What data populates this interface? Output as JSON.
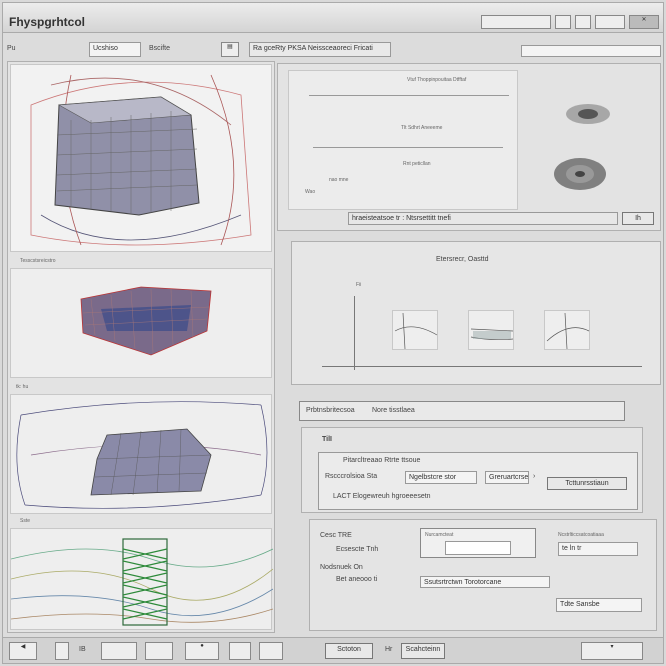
{
  "window": {
    "menu_text": "                         ",
    "title": "Fhyspgrhtcol",
    "title_buttons": [
      "",
      "",
      "",
      "",
      ""
    ]
  },
  "toolbar": {
    "left_label": "Pu",
    "field_a": "Ucshiso",
    "field_b": "Bscifte",
    "path_label": "Ra gceRty PKSA Neissceaoreci Fricati",
    "search_value": ""
  },
  "left_panel": {
    "view2_label": "Tesscstsreicstro",
    "view3_label": "tk: hu",
    "view4_label": "Sste"
  },
  "right_top": {
    "header": "Vtuf Thoppinpouitaa Dtfftaf",
    "line1": "Tlt Sdhrt Aneeeme",
    "line2": "Rnt peticllan",
    "line3": "nao mne",
    "row_label": "Wao",
    "bottom_field": "hraeisteatsoe tr : Ntsrsettitt tnefi",
    "bottom_btn": "Ih",
    "footer_left": "",
    "footer_right": ""
  },
  "chart_panel": {
    "title": "Etersrecr, Oasttd",
    "y_tick": "Fii",
    "thumb_labels": [
      "",
      "",
      ""
    ]
  },
  "tabbar": {
    "tab1": "Prbtnsbritecsoa",
    "tab2": "Nore tisstlaea"
  },
  "settings": {
    "header": "TilI",
    "row1": "Pitarcltreaao Rtrte ttsoue",
    "row2_label": "Rscccrolsioa Sta",
    "row2_field": "Ngelbstcre stor",
    "row2_field2": "Greruartcrseb",
    "row2_btn": "Tcttunrsstiaun",
    "row3": "LACT Elogewreuh hgroeeesetn"
  },
  "options": {
    "item1": "Cesc TRE",
    "item2": "Ecsescte Tnh",
    "item3": "Nodsnuek On",
    "item4": "Bet aneooo ti",
    "field_label": "Nurcamcteat",
    "field_value": "",
    "footer_field": "Ssutsrtrctwn Torotorcane",
    "side_label": "Ncstrlticcsatcoatiaaa",
    "side_field": "te ln tr",
    "bottom_right": "Tdte Sansbe"
  },
  "bottombar": {
    "btn1": "IB",
    "btn2": "Sctoton",
    "btn3": "Scahcteinn",
    "btn3_prefix": "Hr"
  }
}
